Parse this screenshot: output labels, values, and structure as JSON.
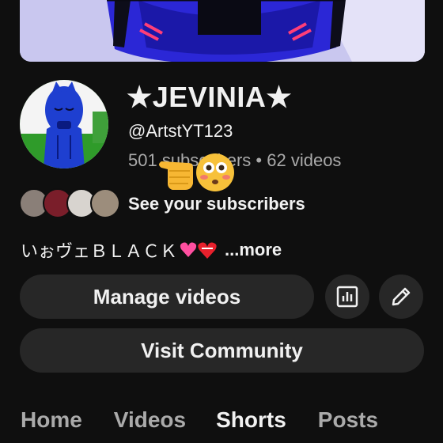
{
  "channel": {
    "name": "★JEVINIA★",
    "handle": "@ArtstYT123",
    "subscribers_text": "501 subscribers",
    "videos_text": "62 videos",
    "separator": " • "
  },
  "subscribers_link": "See your subscribers",
  "description": {
    "text": "いぉヴェＢＬＡＣＫ",
    "more_label": "...more"
  },
  "buttons": {
    "manage_videos": "Manage videos",
    "visit_community": "Visit Community"
  },
  "icons": {
    "analytics": "bar-chart-icon",
    "edit": "pencil-icon"
  },
  "tabs": [
    {
      "label": "Home",
      "active": false
    },
    {
      "label": "Videos",
      "active": false
    },
    {
      "label": "Shorts",
      "active": true
    },
    {
      "label": "Posts",
      "active": false
    }
  ],
  "colors": {
    "background": "#0f0f0f",
    "button_bg": "#272727",
    "text_primary": "#f1f1f1",
    "text_secondary": "#aaaaaa"
  }
}
